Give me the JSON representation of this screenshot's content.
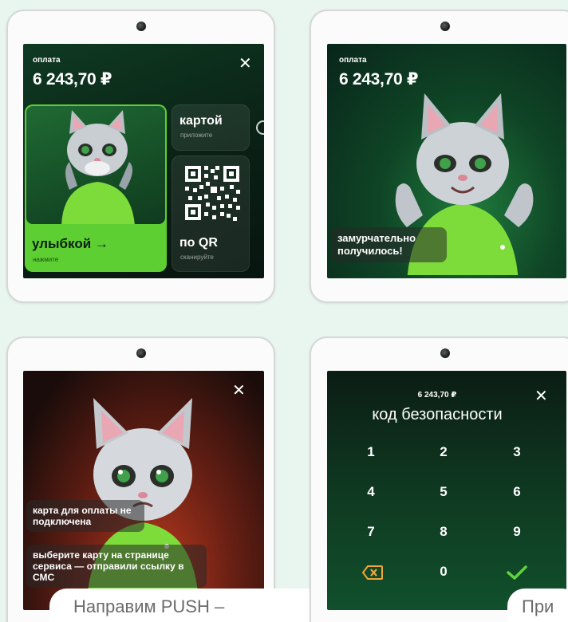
{
  "screen1": {
    "pay_label": "оплата",
    "amount": "6 243,70 ₽",
    "smile_title": "улыбкой →",
    "smile_sub": "нажмите",
    "card_title": "картой",
    "card_sub": "приложите",
    "qr_title": "по QR",
    "qr_sub": "сканируйте"
  },
  "screen2": {
    "pay_label": "оплата",
    "amount": "6 243,70 ₽",
    "message": "замурчательно получилось!"
  },
  "screen3": {
    "message1": "карта для оплаты не подключена",
    "message2": "выберите карту на странице сервиса — отправили ссылку в СМС"
  },
  "screen4": {
    "amount": "6 243,70 ₽",
    "title": "код безопасности",
    "keys": [
      "1",
      "2",
      "3",
      "4",
      "5",
      "6",
      "7",
      "8",
      "9",
      "0"
    ]
  },
  "captions": {
    "left": "Направим PUSH –",
    "right": "При"
  },
  "colors": {
    "accent_green": "#5ecf33",
    "confirm_green": "#5ed43a",
    "delete_orange": "#f0a63a"
  }
}
